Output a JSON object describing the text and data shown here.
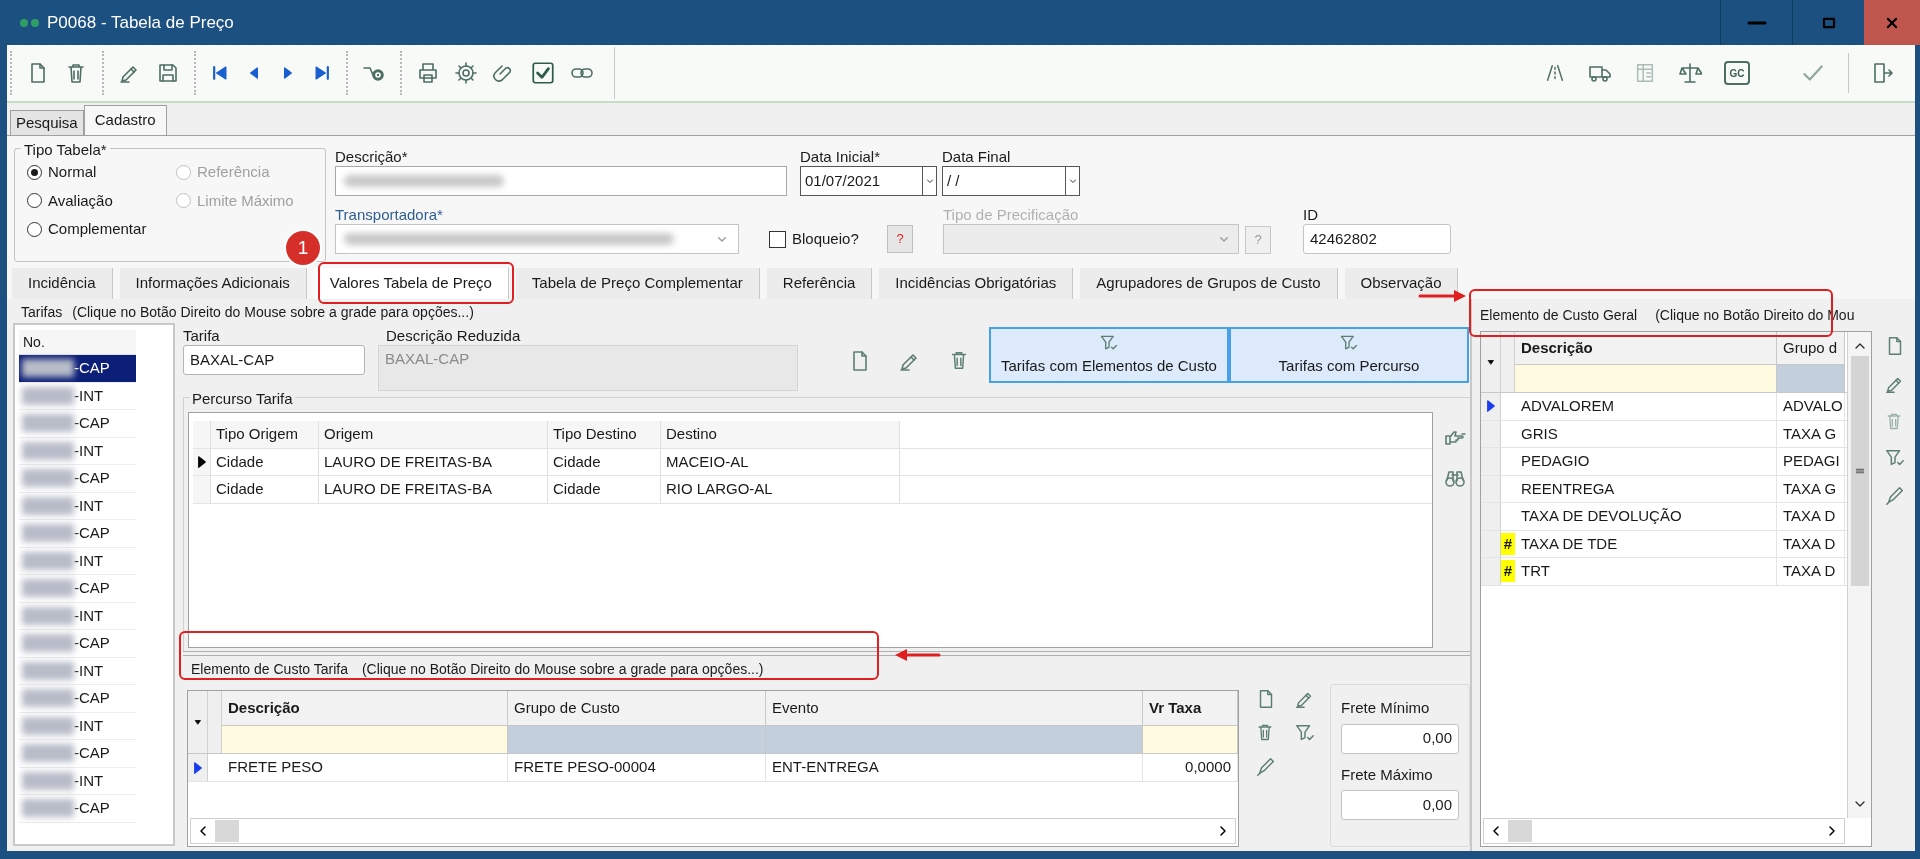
{
  "window": {
    "title": "P0068 - Tabela de Preço"
  },
  "toolbar_badge": "GC",
  "main_tabs": [
    {
      "label": "Pesquisa",
      "selected": false
    },
    {
      "label": "Cadastro",
      "selected": true
    }
  ],
  "tipo_tabela": {
    "legend": "Tipo Tabela*",
    "options": [
      {
        "label": "Normal",
        "selected": true,
        "disabled": false
      },
      {
        "label": "Referência",
        "selected": false,
        "disabled": true
      },
      {
        "label": "Avaliação",
        "selected": false,
        "disabled": false
      },
      {
        "label": "Limite Máximo",
        "selected": false,
        "disabled": true
      },
      {
        "label": "Complementar",
        "selected": false,
        "disabled": false
      }
    ]
  },
  "descricao": {
    "label": "Descrição*",
    "redacted": true
  },
  "data_inicial": {
    "label": "Data Inicial*",
    "value": "01/07/2021"
  },
  "data_final": {
    "label": "Data Final",
    "value": "/ /"
  },
  "transportadora": {
    "label": "Transportadora*",
    "redacted": true
  },
  "bloqueio": {
    "label": "Bloqueio?",
    "checked": false,
    "help": "?"
  },
  "tipo_precificacao": {
    "label": "Tipo de Precificação",
    "disabled": true,
    "help": "?"
  },
  "id": {
    "label": "ID",
    "value": "42462802"
  },
  "annotation_badge": "1",
  "tabs": [
    {
      "label": "Incidência",
      "selected": false
    },
    {
      "label": "Informações Adicionais",
      "selected": false
    },
    {
      "label": "Valores Tabela de Preço",
      "selected": true
    },
    {
      "label": "Tabela de Preço Complementar",
      "selected": false
    },
    {
      "label": "Referência",
      "selected": false
    },
    {
      "label": "Incidências Obrigatórias",
      "selected": false
    },
    {
      "label": "Agrupadores de Grupos de Custo",
      "selected": false
    },
    {
      "label": "Observação",
      "selected": false
    }
  ],
  "tarifas": {
    "title": "Tarifas",
    "hint": "(Clique no Botão Direito do Mouse sobre a grade para opções...)",
    "column": "No.",
    "rows": [
      {
        "suffix": "-CAP",
        "selected": true
      },
      {
        "suffix": "-INT",
        "selected": false
      },
      {
        "suffix": "-CAP",
        "selected": false
      },
      {
        "suffix": "-INT",
        "selected": false
      },
      {
        "suffix": "-CAP",
        "selected": false
      },
      {
        "suffix": "-INT",
        "selected": false
      },
      {
        "suffix": "-CAP",
        "selected": false
      },
      {
        "suffix": "-INT",
        "selected": false
      },
      {
        "suffix": "-CAP",
        "selected": false
      },
      {
        "suffix": "-INT",
        "selected": false
      },
      {
        "suffix": "-CAP",
        "selected": false
      },
      {
        "suffix": "-INT",
        "selected": false
      },
      {
        "suffix": "-CAP",
        "selected": false
      },
      {
        "suffix": "-INT",
        "selected": false
      },
      {
        "suffix": "-CAP",
        "selected": false
      },
      {
        "suffix": "-INT",
        "selected": false
      },
      {
        "suffix": "-CAP",
        "selected": false
      }
    ]
  },
  "tarifa": {
    "label": "Tarifa",
    "value": "BAXAL-CAP"
  },
  "descricao_reduzida": {
    "label": "Descrição Reduzida",
    "value": "BAXAL-CAP",
    "disabled": true
  },
  "filter_buttons": [
    "Tarifas com Elementos de Custo",
    "Tarifas com Percurso"
  ],
  "percurso": {
    "title": "Percurso Tarifa",
    "columns": [
      "Tipo Origem",
      "Origem",
      "Tipo Destino",
      "Destino"
    ],
    "rows": [
      {
        "cells": [
          "Cidade",
          "LAURO DE FREITAS-BA",
          "Cidade",
          "MACEIO-AL"
        ],
        "current": true
      },
      {
        "cells": [
          "Cidade",
          "LAURO DE FREITAS-BA",
          "Cidade",
          "RIO LARGO-AL"
        ],
        "current": false
      }
    ]
  },
  "elemento_tarifa": {
    "title": "Elemento de Custo Tarifa",
    "hint": "(Clique no Botão Direito do Mouse sobre a grade para opções...)",
    "columns": [
      "Descrição",
      "Grupo de Custo",
      "Evento",
      "Vr Taxa"
    ],
    "rows": [
      {
        "cells": [
          "FRETE PESO",
          "FRETE PESO-00004",
          "ENT-ENTREGA",
          "0,0000"
        ],
        "current": true
      }
    ]
  },
  "frete_minimo": {
    "label": "Frete Mínimo",
    "value": "0,00"
  },
  "frete_maximo": {
    "label": "Frete Máximo",
    "value": "0,00"
  },
  "elemento_geral": {
    "title": "Elemento de Custo Geral",
    "hint": "(Clique no Botão Direito do Mou",
    "columns": [
      "Descrição",
      "Grupo d"
    ],
    "rows": [
      {
        "cells": [
          "ADVALOREM",
          "ADVALO"
        ],
        "current": true
      },
      {
        "cells": [
          "GRIS",
          "TAXA G"
        ],
        "current": false
      },
      {
        "cells": [
          "PEDAGIO",
          "PEDAGI"
        ],
        "current": false
      },
      {
        "cells": [
          "REENTREGA",
          "TAXA G"
        ],
        "current": false
      },
      {
        "cells": [
          "TAXA DE DEVOLUÇÃO",
          "TAXA D"
        ],
        "current": false
      },
      {
        "cells": [
          "TAXA DE TDE",
          "TAXA D"
        ],
        "current": false,
        "flag": "#"
      },
      {
        "cells": [
          "TRT",
          "TAXA D"
        ],
        "current": false,
        "flag": "#"
      }
    ]
  }
}
